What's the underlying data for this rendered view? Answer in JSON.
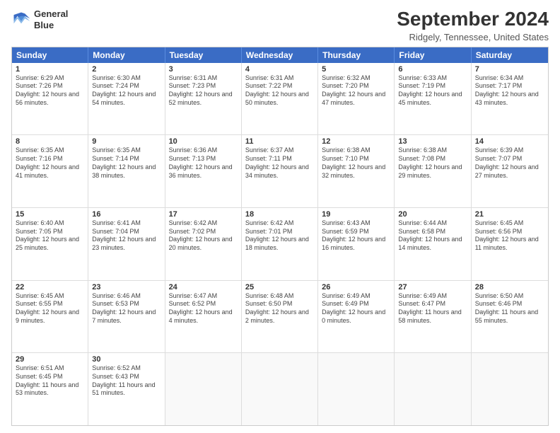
{
  "logo": {
    "line1": "General",
    "line2": "Blue"
  },
  "title": "September 2024",
  "subtitle": "Ridgely, Tennessee, United States",
  "headers": [
    "Sunday",
    "Monday",
    "Tuesday",
    "Wednesday",
    "Thursday",
    "Friday",
    "Saturday"
  ],
  "weeks": [
    [
      {
        "day": "1",
        "sunrise": "Sunrise: 6:29 AM",
        "sunset": "Sunset: 7:26 PM",
        "daylight": "Daylight: 12 hours and 56 minutes."
      },
      {
        "day": "2",
        "sunrise": "Sunrise: 6:30 AM",
        "sunset": "Sunset: 7:24 PM",
        "daylight": "Daylight: 12 hours and 54 minutes."
      },
      {
        "day": "3",
        "sunrise": "Sunrise: 6:31 AM",
        "sunset": "Sunset: 7:23 PM",
        "daylight": "Daylight: 12 hours and 52 minutes."
      },
      {
        "day": "4",
        "sunrise": "Sunrise: 6:31 AM",
        "sunset": "Sunset: 7:22 PM",
        "daylight": "Daylight: 12 hours and 50 minutes."
      },
      {
        "day": "5",
        "sunrise": "Sunrise: 6:32 AM",
        "sunset": "Sunset: 7:20 PM",
        "daylight": "Daylight: 12 hours and 47 minutes."
      },
      {
        "day": "6",
        "sunrise": "Sunrise: 6:33 AM",
        "sunset": "Sunset: 7:19 PM",
        "daylight": "Daylight: 12 hours and 45 minutes."
      },
      {
        "day": "7",
        "sunrise": "Sunrise: 6:34 AM",
        "sunset": "Sunset: 7:17 PM",
        "daylight": "Daylight: 12 hours and 43 minutes."
      }
    ],
    [
      {
        "day": "8",
        "sunrise": "Sunrise: 6:35 AM",
        "sunset": "Sunset: 7:16 PM",
        "daylight": "Daylight: 12 hours and 41 minutes."
      },
      {
        "day": "9",
        "sunrise": "Sunrise: 6:35 AM",
        "sunset": "Sunset: 7:14 PM",
        "daylight": "Daylight: 12 hours and 38 minutes."
      },
      {
        "day": "10",
        "sunrise": "Sunrise: 6:36 AM",
        "sunset": "Sunset: 7:13 PM",
        "daylight": "Daylight: 12 hours and 36 minutes."
      },
      {
        "day": "11",
        "sunrise": "Sunrise: 6:37 AM",
        "sunset": "Sunset: 7:11 PM",
        "daylight": "Daylight: 12 hours and 34 minutes."
      },
      {
        "day": "12",
        "sunrise": "Sunrise: 6:38 AM",
        "sunset": "Sunset: 7:10 PM",
        "daylight": "Daylight: 12 hours and 32 minutes."
      },
      {
        "day": "13",
        "sunrise": "Sunrise: 6:38 AM",
        "sunset": "Sunset: 7:08 PM",
        "daylight": "Daylight: 12 hours and 29 minutes."
      },
      {
        "day": "14",
        "sunrise": "Sunrise: 6:39 AM",
        "sunset": "Sunset: 7:07 PM",
        "daylight": "Daylight: 12 hours and 27 minutes."
      }
    ],
    [
      {
        "day": "15",
        "sunrise": "Sunrise: 6:40 AM",
        "sunset": "Sunset: 7:05 PM",
        "daylight": "Daylight: 12 hours and 25 minutes."
      },
      {
        "day": "16",
        "sunrise": "Sunrise: 6:41 AM",
        "sunset": "Sunset: 7:04 PM",
        "daylight": "Daylight: 12 hours and 23 minutes."
      },
      {
        "day": "17",
        "sunrise": "Sunrise: 6:42 AM",
        "sunset": "Sunset: 7:02 PM",
        "daylight": "Daylight: 12 hours and 20 minutes."
      },
      {
        "day": "18",
        "sunrise": "Sunrise: 6:42 AM",
        "sunset": "Sunset: 7:01 PM",
        "daylight": "Daylight: 12 hours and 18 minutes."
      },
      {
        "day": "19",
        "sunrise": "Sunrise: 6:43 AM",
        "sunset": "Sunset: 6:59 PM",
        "daylight": "Daylight: 12 hours and 16 minutes."
      },
      {
        "day": "20",
        "sunrise": "Sunrise: 6:44 AM",
        "sunset": "Sunset: 6:58 PM",
        "daylight": "Daylight: 12 hours and 14 minutes."
      },
      {
        "day": "21",
        "sunrise": "Sunrise: 6:45 AM",
        "sunset": "Sunset: 6:56 PM",
        "daylight": "Daylight: 12 hours and 11 minutes."
      }
    ],
    [
      {
        "day": "22",
        "sunrise": "Sunrise: 6:45 AM",
        "sunset": "Sunset: 6:55 PM",
        "daylight": "Daylight: 12 hours and 9 minutes."
      },
      {
        "day": "23",
        "sunrise": "Sunrise: 6:46 AM",
        "sunset": "Sunset: 6:53 PM",
        "daylight": "Daylight: 12 hours and 7 minutes."
      },
      {
        "day": "24",
        "sunrise": "Sunrise: 6:47 AM",
        "sunset": "Sunset: 6:52 PM",
        "daylight": "Daylight: 12 hours and 4 minutes."
      },
      {
        "day": "25",
        "sunrise": "Sunrise: 6:48 AM",
        "sunset": "Sunset: 6:50 PM",
        "daylight": "Daylight: 12 hours and 2 minutes."
      },
      {
        "day": "26",
        "sunrise": "Sunrise: 6:49 AM",
        "sunset": "Sunset: 6:49 PM",
        "daylight": "Daylight: 12 hours and 0 minutes."
      },
      {
        "day": "27",
        "sunrise": "Sunrise: 6:49 AM",
        "sunset": "Sunset: 6:47 PM",
        "daylight": "Daylight: 11 hours and 58 minutes."
      },
      {
        "day": "28",
        "sunrise": "Sunrise: 6:50 AM",
        "sunset": "Sunset: 6:46 PM",
        "daylight": "Daylight: 11 hours and 55 minutes."
      }
    ],
    [
      {
        "day": "29",
        "sunrise": "Sunrise: 6:51 AM",
        "sunset": "Sunset: 6:45 PM",
        "daylight": "Daylight: 11 hours and 53 minutes."
      },
      {
        "day": "30",
        "sunrise": "Sunrise: 6:52 AM",
        "sunset": "Sunset: 6:43 PM",
        "daylight": "Daylight: 11 hours and 51 minutes."
      },
      {
        "day": "",
        "sunrise": "",
        "sunset": "",
        "daylight": ""
      },
      {
        "day": "",
        "sunrise": "",
        "sunset": "",
        "daylight": ""
      },
      {
        "day": "",
        "sunrise": "",
        "sunset": "",
        "daylight": ""
      },
      {
        "day": "",
        "sunrise": "",
        "sunset": "",
        "daylight": ""
      },
      {
        "day": "",
        "sunrise": "",
        "sunset": "",
        "daylight": ""
      }
    ]
  ]
}
